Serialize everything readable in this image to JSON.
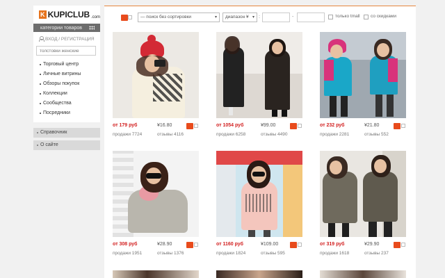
{
  "logo": {
    "badge": "K",
    "name": "KUPICLUB",
    "domain": ".com"
  },
  "sidebar": {
    "categories_label": "категории товаров",
    "login_label": "ВХОД / РЕГИСТРАЦИЯ",
    "search_value": "толстовки женские",
    "nav_items": [
      "Торговый центр",
      "Личные витрины",
      "Обзоры покупок",
      "Коллекции",
      "Сообщества",
      "Посредники"
    ],
    "buttons": [
      "Справочник",
      "О сайте"
    ]
  },
  "filter": {
    "sort_value": "— поиск без сортировки",
    "range_value": "диапазон ¥",
    "colon": ":",
    "range_sep": "-",
    "only_tmall": "только tmall",
    "with_discounts": "со скидками"
  },
  "products": [
    {
      "price_rub": "от 179 руб",
      "price_cny": "¥16.80",
      "sales": "продажи 7724",
      "reviews": "отзывы 4116"
    },
    {
      "price_rub": "от 1054 руб",
      "price_cny": "¥99.00",
      "sales": "продажи 6258",
      "reviews": "отзывы 4490"
    },
    {
      "price_rub": "от 232 руб",
      "price_cny": "¥21.80",
      "sales": "продажи 2281",
      "reviews": "отзывы 552"
    },
    {
      "price_rub": "от 308 руб",
      "price_cny": "¥28.90",
      "sales": "продажи 1951",
      "reviews": "отзывы 1376"
    },
    {
      "price_rub": "от 1160 руб",
      "price_cny": "¥109.00",
      "sales": "продажи 1824",
      "reviews": "отзывы 595"
    },
    {
      "price_rub": "от 319 руб",
      "price_cny": "¥29.90",
      "sales": "продажи 1618",
      "reviews": "отзывы 237"
    }
  ],
  "colors": {
    "accent": "#e5863c",
    "price": "#d21f1f",
    "taobao": "#e84b1c"
  }
}
